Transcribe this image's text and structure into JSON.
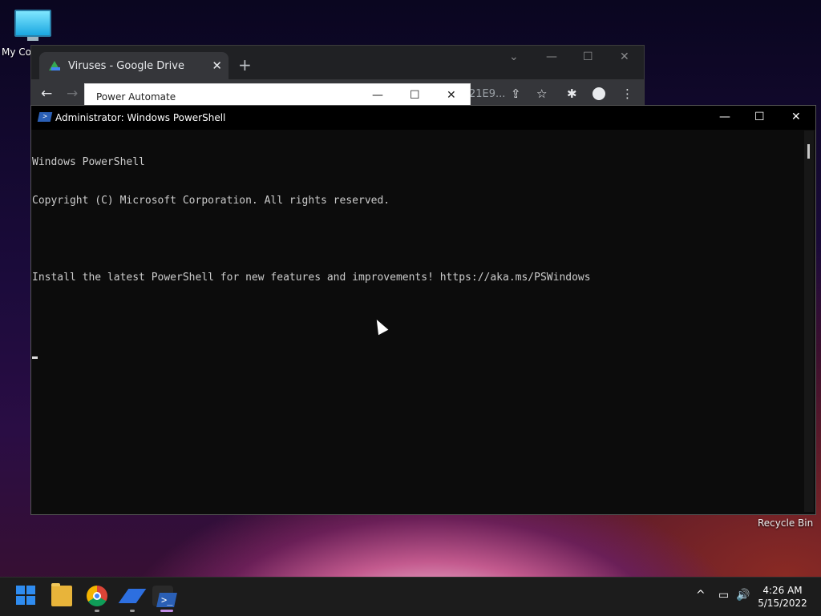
{
  "desktop": {
    "icons": [
      {
        "label": "My Co"
      },
      {
        "label": "Recycle Bin"
      }
    ]
  },
  "chrome": {
    "tab_title": "Viruses - Google Drive",
    "tab_close": "✕",
    "new_tab": "+",
    "url_fragment": "21E9...",
    "controls": {
      "dropdown": "⌄",
      "minimize": "—",
      "maximize": "☐",
      "close": "✕"
    },
    "nav": {
      "back": "←",
      "forward": "→"
    },
    "icons": {
      "share": "⇪",
      "star": "☆",
      "extensions": "✱",
      "menu": "⋮"
    }
  },
  "power_automate": {
    "title": "Power Automate",
    "controls": {
      "minimize": "—",
      "maximize": "☐",
      "close": "✕"
    }
  },
  "powershell": {
    "title": "Administrator: Windows PowerShell",
    "controls": {
      "minimize": "—",
      "maximize": "☐",
      "close": "✕"
    },
    "lines": [
      "Windows PowerShell",
      "Copyright (C) Microsoft Corporation. All rights reserved.",
      "",
      "Install the latest PowerShell for new features and improvements! https://aka.ms/PSWindows",
      ""
    ]
  },
  "taskbar": {
    "clock": {
      "time": "4:26 AM",
      "date": "5/15/2022"
    },
    "tray": {
      "chevron": "^",
      "network": "▭",
      "volume": "🔊"
    },
    "ps_glyph": ">_"
  },
  "colors": {
    "accent_indicator": "#c28ee8",
    "start_blue": "#2f8cf0",
    "console_bg": "#0c0c0c",
    "console_text": "#cccccc"
  }
}
